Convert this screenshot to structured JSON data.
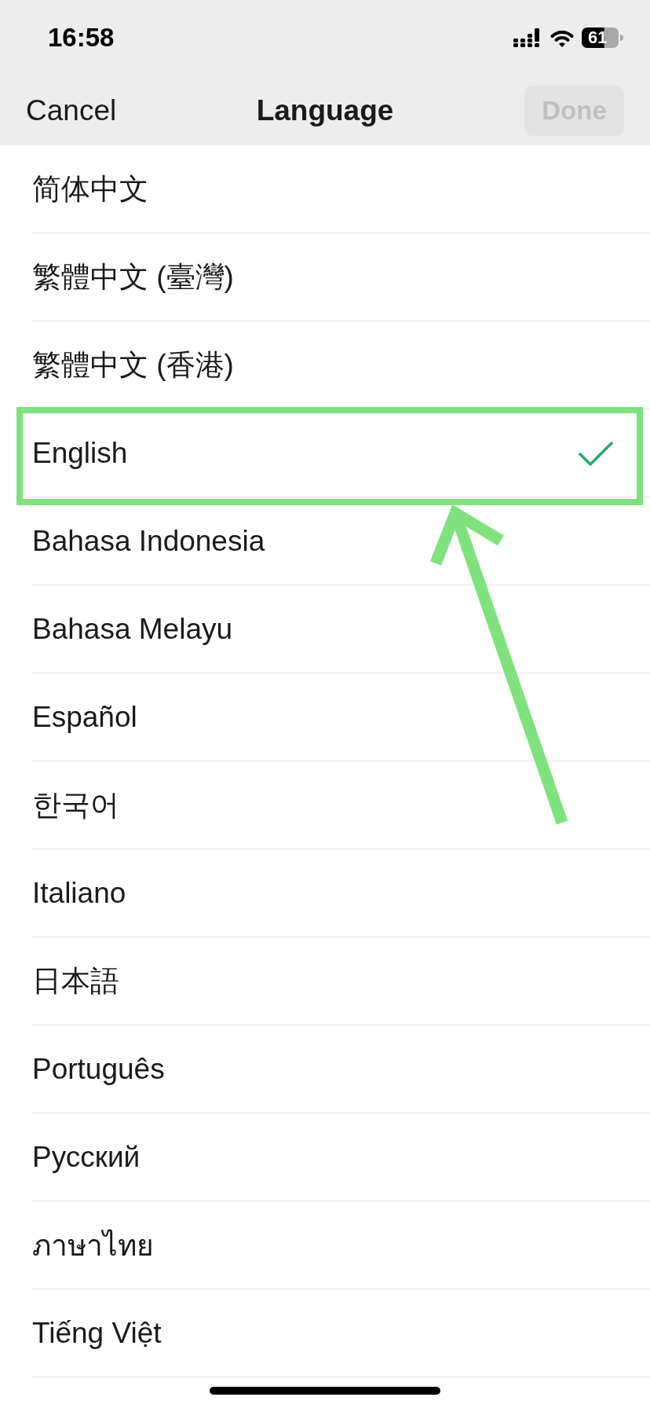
{
  "status_bar": {
    "time": "16:58",
    "battery": "61"
  },
  "nav": {
    "cancel": "Cancel",
    "title": "Language",
    "done": {
      "label": "Done",
      "disabled": true
    }
  },
  "languages": [
    {
      "label": "简体中文",
      "selected": false,
      "highlighted": false
    },
    {
      "label": "繁體中文 (臺灣)",
      "selected": false,
      "highlighted": false
    },
    {
      "label": "繁體中文 (香港)",
      "selected": false,
      "highlighted": false
    },
    {
      "label": "English",
      "selected": true,
      "highlighted": true
    },
    {
      "label": "Bahasa Indonesia",
      "selected": false,
      "highlighted": false
    },
    {
      "label": "Bahasa Melayu",
      "selected": false,
      "highlighted": false
    },
    {
      "label": "Español",
      "selected": false,
      "highlighted": false
    },
    {
      "label": "한국어",
      "selected": false,
      "highlighted": false
    },
    {
      "label": "Italiano",
      "selected": false,
      "highlighted": false
    },
    {
      "label": "日本語",
      "selected": false,
      "highlighted": false
    },
    {
      "label": "Português",
      "selected": false,
      "highlighted": false
    },
    {
      "label": "Русский",
      "selected": false,
      "highlighted": false
    },
    {
      "label": "ภาษาไทย",
      "selected": false,
      "highlighted": false
    },
    {
      "label": "Tiếng Việt",
      "selected": false,
      "highlighted": false
    }
  ]
}
